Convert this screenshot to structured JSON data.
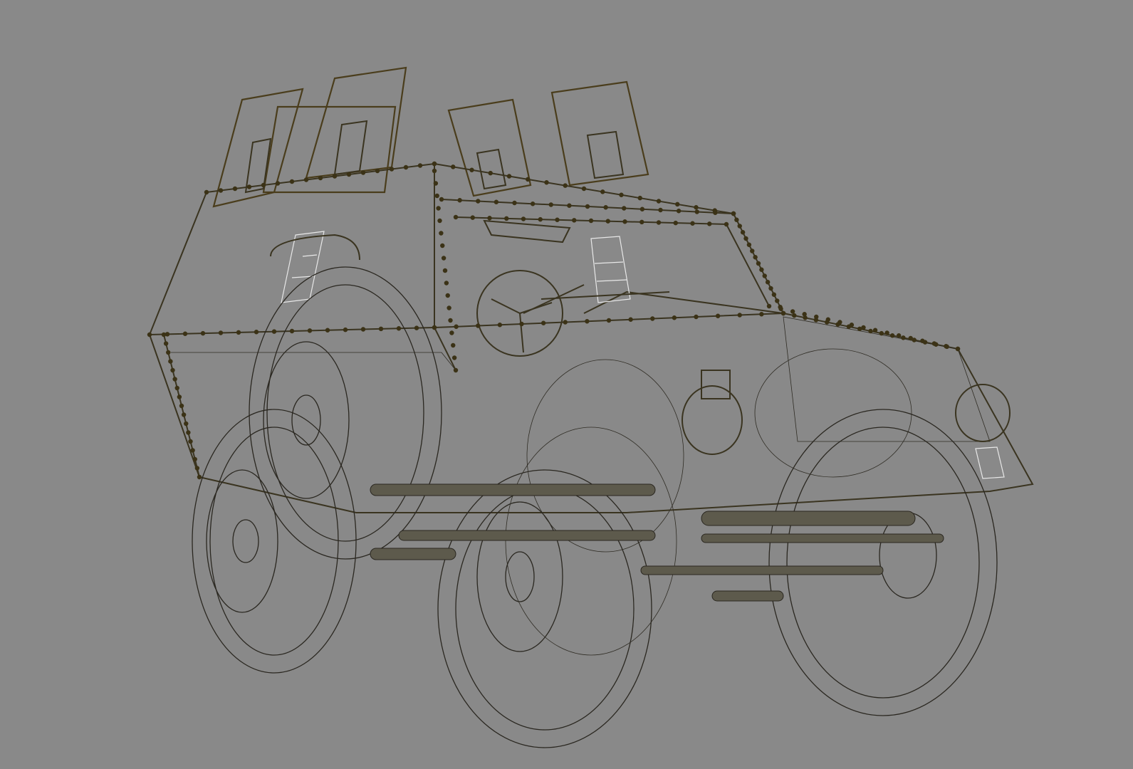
{
  "viewport": {
    "name": "3d-wireframe-viewport",
    "background_color": "#898989",
    "wire_color": "#2a2720",
    "frame_color": "#3a3420",
    "rivet_color": "#3b3216",
    "glass_color": "#e8e8e8",
    "display_mode": "wireframe",
    "model": "armored-vehicle"
  }
}
